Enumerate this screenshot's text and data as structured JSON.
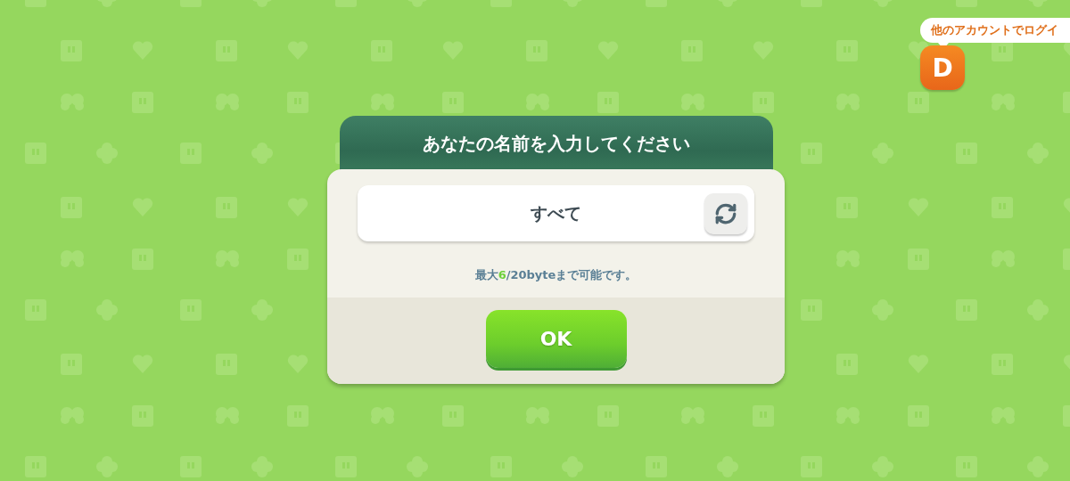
{
  "dialog": {
    "title": "あなたの名前を入力してください",
    "name_field": {
      "value": "すべて"
    },
    "hint": {
      "prefix": "最大",
      "count": "6",
      "suffix": "/20byteまで可能です。"
    },
    "ok_button": "OK"
  },
  "account": {
    "tooltip": "他のアカウントでログイ",
    "avatar_letter": "D"
  }
}
